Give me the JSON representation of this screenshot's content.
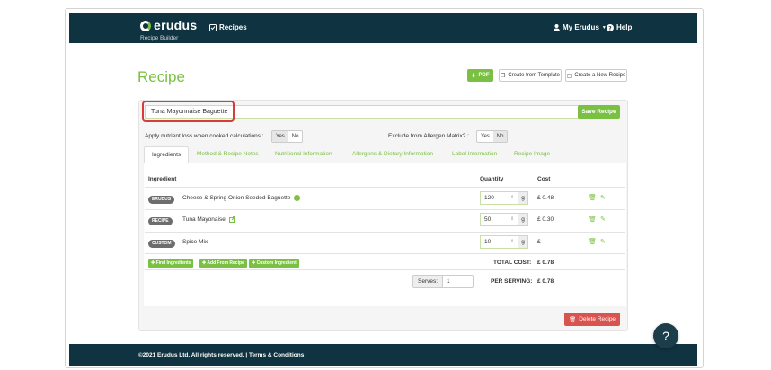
{
  "brand": {
    "name": "erudus",
    "subtitle": "Recipe Builder"
  },
  "nav": {
    "recipes": "Recipes",
    "account": "My Erudus",
    "help": "Help"
  },
  "page": {
    "title": "Recipe"
  },
  "actions": {
    "pdf": "PDF",
    "create_from_template": "Create from Template",
    "create_new": "Create a New Recipe"
  },
  "recipe_name": {
    "value": "Tuna Mayonnaise Baguette"
  },
  "save_label": "Save Recipe",
  "options": {
    "nutrient_loss_label": "Apply nutrient loss when cooked calculations :",
    "nutrient_yes": "Yes",
    "nutrient_no": "No",
    "allergen_label": "Exclude from Allergen Matrix? :",
    "allergen_yes": "Yes",
    "allergen_no": "No"
  },
  "tabs": [
    {
      "label": "Ingredients"
    },
    {
      "label": "Method & Recipe Notes"
    },
    {
      "label": "Nutritional Information"
    },
    {
      "label": "Allergens & Dietary Information"
    },
    {
      "label": "Label Information"
    },
    {
      "label": "Recipe Image"
    }
  ],
  "table": {
    "headers": {
      "ingredient": "Ingredient",
      "quantity": "Quantity",
      "cost": "Cost"
    },
    "rows": [
      {
        "tag": "ERUDUS",
        "name": "Cheese & Spring Onion Seeded Baguette",
        "qty": "120",
        "unit": "g",
        "cost": "£ 0.48"
      },
      {
        "tag": "RECIPE",
        "name": "Tuna Mayonaise",
        "qty": "50",
        "unit": "g",
        "cost": "£ 0.30"
      },
      {
        "tag": "CUSTOM",
        "name": "Spice Mix",
        "qty": "10",
        "unit": "g",
        "cost": "£"
      }
    ]
  },
  "add_buttons": {
    "find": "Find Ingredients",
    "from_recipe": "Add From Recipe",
    "custom": "Custom Ingredient"
  },
  "totals": {
    "total_label": "TOTAL COST:",
    "total_value": "£ 0.78",
    "serves_label": "Serves:",
    "serves_value": "1",
    "per_serving_label": "PER SERVING:",
    "per_serving_value": "£ 0.78"
  },
  "delete_label": "Delete Recipe",
  "footer": {
    "text": "©2021 Erudus Ltd. All rights reserved. | Terms & Conditions"
  },
  "help_fab": "?",
  "colors": {
    "brand_green": "#7ac143",
    "nav_bg": "#0f3340",
    "danger": "#d9534f",
    "highlight": "#d93b3b"
  }
}
